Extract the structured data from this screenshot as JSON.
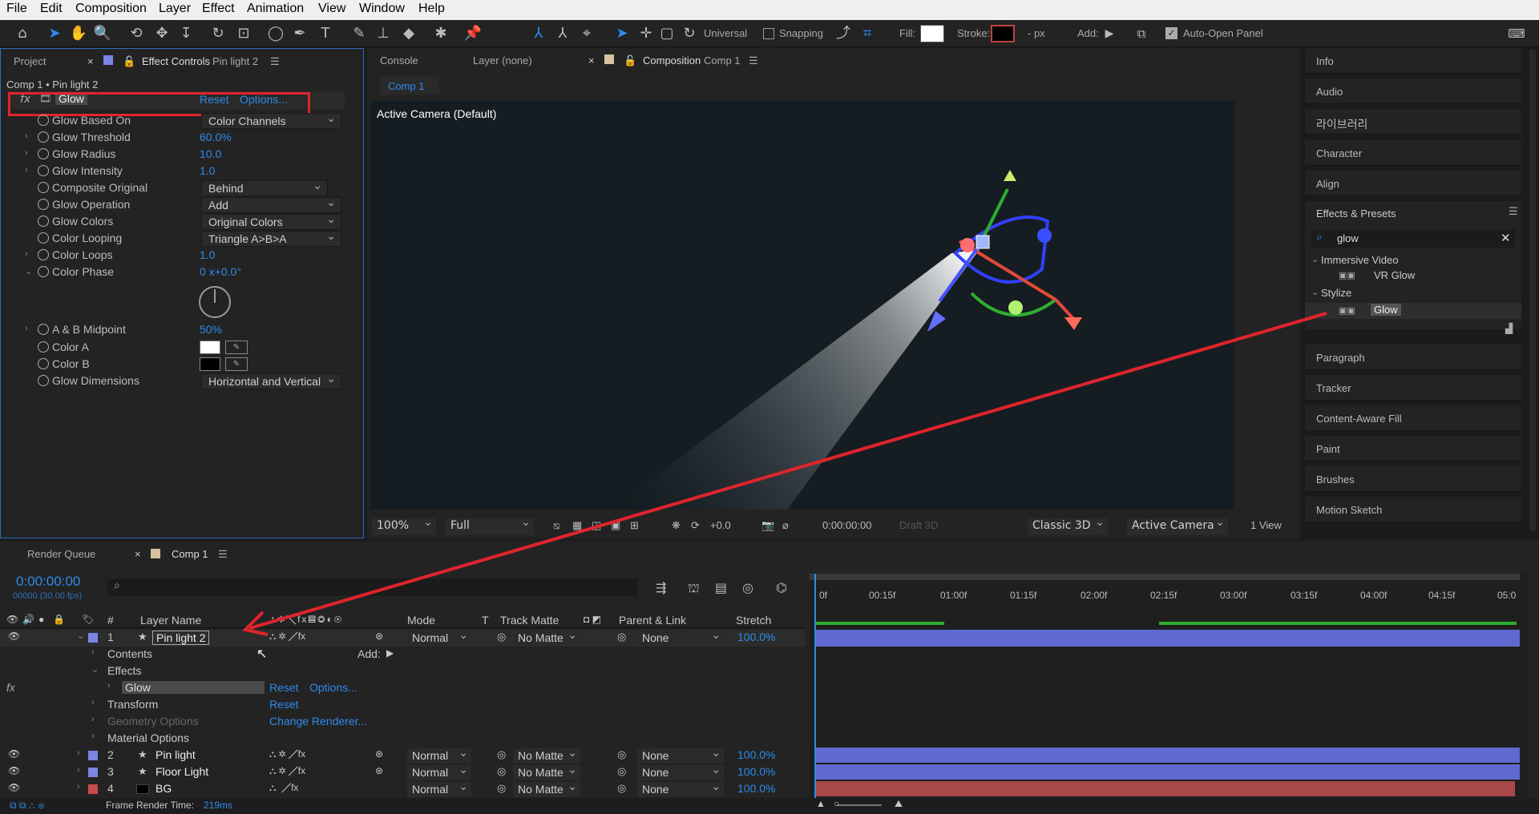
{
  "menu": [
    "File",
    "Edit",
    "Composition",
    "Layer",
    "Effect",
    "Animation",
    "View",
    "Window",
    "Help"
  ],
  "toolbar": {
    "universal": "Universal",
    "snapping": "Snapping",
    "fill": "Fill:",
    "stroke": "Stroke:",
    "stroke_unit": "- px",
    "add": "Add:",
    "auto_open": "Auto-Open Panel"
  },
  "left_tabs": {
    "project": "Project",
    "effect_controls": "Effect Controls",
    "effect_layer": "Pin light 2"
  },
  "breadcrumb": "Comp 1 • Pin light 2",
  "effect": {
    "name": "Glow",
    "reset": "Reset",
    "options": "Options..."
  },
  "props": [
    {
      "name": "Glow Based On",
      "dd": "Color Channels"
    },
    {
      "name": "Glow Threshold",
      "value": "60.0%"
    },
    {
      "name": "Glow Radius",
      "value": "10.0"
    },
    {
      "name": "Glow Intensity",
      "value": "1.0"
    },
    {
      "name": "Composite Original",
      "dd": "Behind"
    },
    {
      "name": "Glow Operation",
      "dd": "Add"
    },
    {
      "name": "Glow Colors",
      "dd": "Original Colors"
    },
    {
      "name": "Color Looping",
      "dd": "Triangle A>B>A"
    },
    {
      "name": "Color Loops",
      "value": "1.0"
    },
    {
      "name": "Color Phase",
      "value": "0 x+0.0°"
    },
    {
      "name": "A & B Midpoint",
      "value": "50%"
    },
    {
      "name": "Color A"
    },
    {
      "name": "Color B"
    },
    {
      "name": "Glow Dimensions",
      "dd": "Horizontal and Vertical"
    }
  ],
  "comp_tabs": {
    "console": "Console",
    "layer": "Layer (none)",
    "composition": "Composition",
    "comp_name": "Comp 1",
    "subtab": "Comp 1"
  },
  "viewer": {
    "camera_label": "Active Camera (Default)"
  },
  "viewer_bar": {
    "zoom": "100%",
    "resolution": "Full",
    "exposure": "+0.0",
    "timecode": "0:00:00:00",
    "draft": "Draft 3D",
    "renderer": "Classic 3D",
    "camera": "Active Camera ...",
    "views": "1 View"
  },
  "right_panel": {
    "top": [
      "Info",
      "Audio",
      "라이브러리",
      "Character",
      "Align"
    ],
    "effects_title": "Effects & Presets",
    "search": "glow",
    "tree": [
      {
        "group": "Immersive Video",
        "item": "VR Glow"
      },
      {
        "group": "Stylize",
        "item": "Glow"
      }
    ],
    "bottom": [
      "Paragraph",
      "Tracker",
      "Content-Aware Fill",
      "Paint",
      "Brushes",
      "Motion Sketch"
    ]
  },
  "timeline": {
    "tabs": {
      "render_queue": "Render Queue",
      "comp": "Comp 1"
    },
    "timecode": "0:00:00:00",
    "frames": "00000 (30.00 fps)",
    "headers": {
      "num": "#",
      "layer_name": "Layer Name",
      "mode": "Mode",
      "t": "T",
      "track_matte": "Track Matte",
      "parent": "Parent & Link",
      "stretch": "Stretch"
    },
    "ruler": [
      "0f",
      "00:15f",
      "01:00f",
      "01:15f",
      "02:00f",
      "02:15f",
      "03:00f",
      "03:15f",
      "04:00f",
      "04:15f",
      "05:0"
    ],
    "layers": [
      {
        "num": "1",
        "name": "Pin light 2",
        "mode": "Normal",
        "matte": "No Matte",
        "parent": "None",
        "stretch": "100.0%",
        "color": "#7b85e6"
      },
      {
        "num": "2",
        "name": "Pin light",
        "mode": "Normal",
        "matte": "No Matte",
        "parent": "None",
        "stretch": "100.0%",
        "color": "#7b85e6"
      },
      {
        "num": "3",
        "name": "Floor Light",
        "mode": "Normal",
        "matte": "No Matte",
        "parent": "None",
        "stretch": "100.0%",
        "color": "#7b85e6"
      },
      {
        "num": "4",
        "name": "BG",
        "mode": "Normal",
        "matte": "No Matte",
        "parent": "None",
        "stretch": "100.0%",
        "color": "#c84a4a"
      }
    ],
    "sub": {
      "contents": "Contents",
      "add": "Add:",
      "effects": "Effects",
      "glow": "Glow",
      "reset": "Reset",
      "options": "Options...",
      "transform": "Transform",
      "reset2": "Reset",
      "geometry": "Geometry Options",
      "change_renderer": "Change Renderer...",
      "material": "Material Options"
    },
    "status_label": "Frame Render Time:",
    "status_value": "219ms"
  }
}
